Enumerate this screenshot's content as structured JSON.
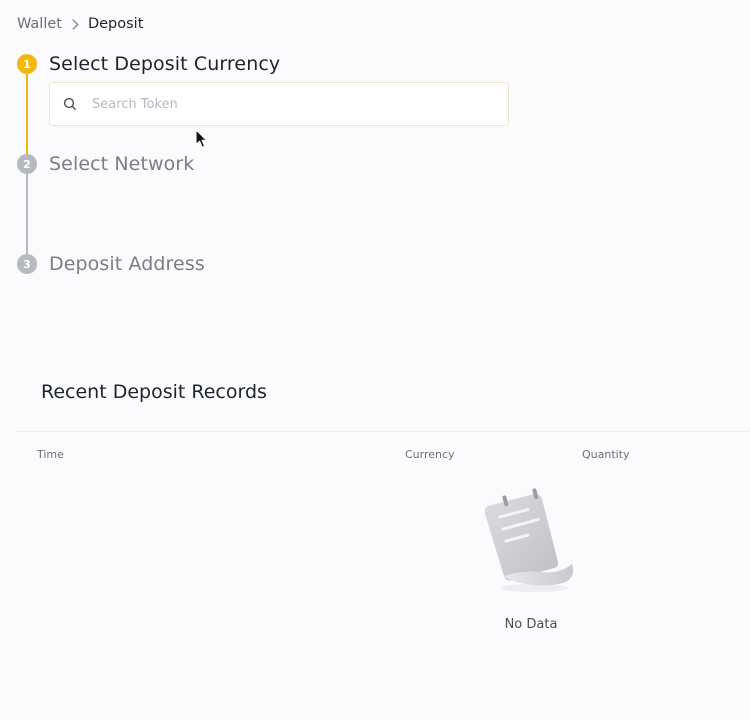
{
  "breadcrumb": {
    "parent": "Wallet",
    "current": "Deposit"
  },
  "steps": [
    {
      "number": "1",
      "title": "Select Deposit Currency",
      "state": "active"
    },
    {
      "number": "2",
      "title": "Select Network",
      "state": "inactive"
    },
    {
      "number": "3",
      "title": "Deposit Address",
      "state": "inactive"
    }
  ],
  "search": {
    "placeholder": "Search Token",
    "value": "",
    "icon": "search-icon"
  },
  "records": {
    "title": "Recent Deposit Records",
    "columns": [
      "Time",
      "Currency",
      "Quantity"
    ],
    "rows": [],
    "empty_text": "No Data",
    "empty_icon": "empty-notepad-icon"
  },
  "colors": {
    "accent": "#f0b90b",
    "inactive": "#b7b9c1",
    "background": "#fbfbfd"
  }
}
